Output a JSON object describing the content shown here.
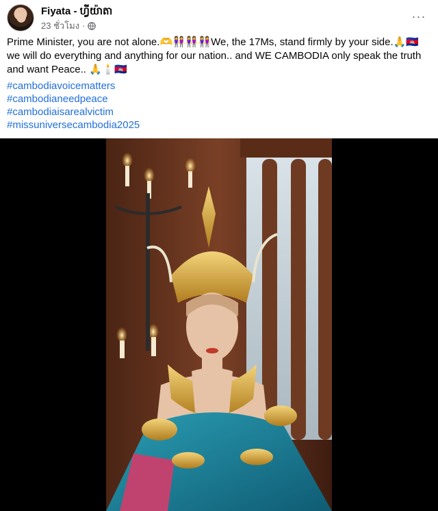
{
  "post": {
    "author": "Fiyata - ហ្វីយ៉ាតា",
    "time": "23 ชั่วโมง",
    "visibility_separator": "·",
    "visibility_icon": "globe-icon",
    "more_icon": "more-options-icon",
    "more_label": "···",
    "text": "Prime Minister, you are not alone.🫶👭👭👭We, the 17Ms, stand firmly by your side.🙏🇰🇭 we will do everything and anything for our nation.. and WE CAMBODIA only speak the truth and want Peace.. 🙏🕯️🇰🇭",
    "hashtags": [
      "#cambodiavoicematters",
      "#cambodianeedpeace",
      "#cambodiaisarealvictim",
      "#missuniversecambodia2025"
    ]
  },
  "video": {
    "content": "portrait-video",
    "colors": {
      "background": "#000000",
      "wood": "#6b3a22",
      "gold": "#d4a437",
      "teal": "#1b8aa0",
      "skin": "#e6c2a6"
    }
  },
  "colors": {
    "link": "#216fdb",
    "secondary_text": "#65676b",
    "primary_text": "#050505"
  }
}
